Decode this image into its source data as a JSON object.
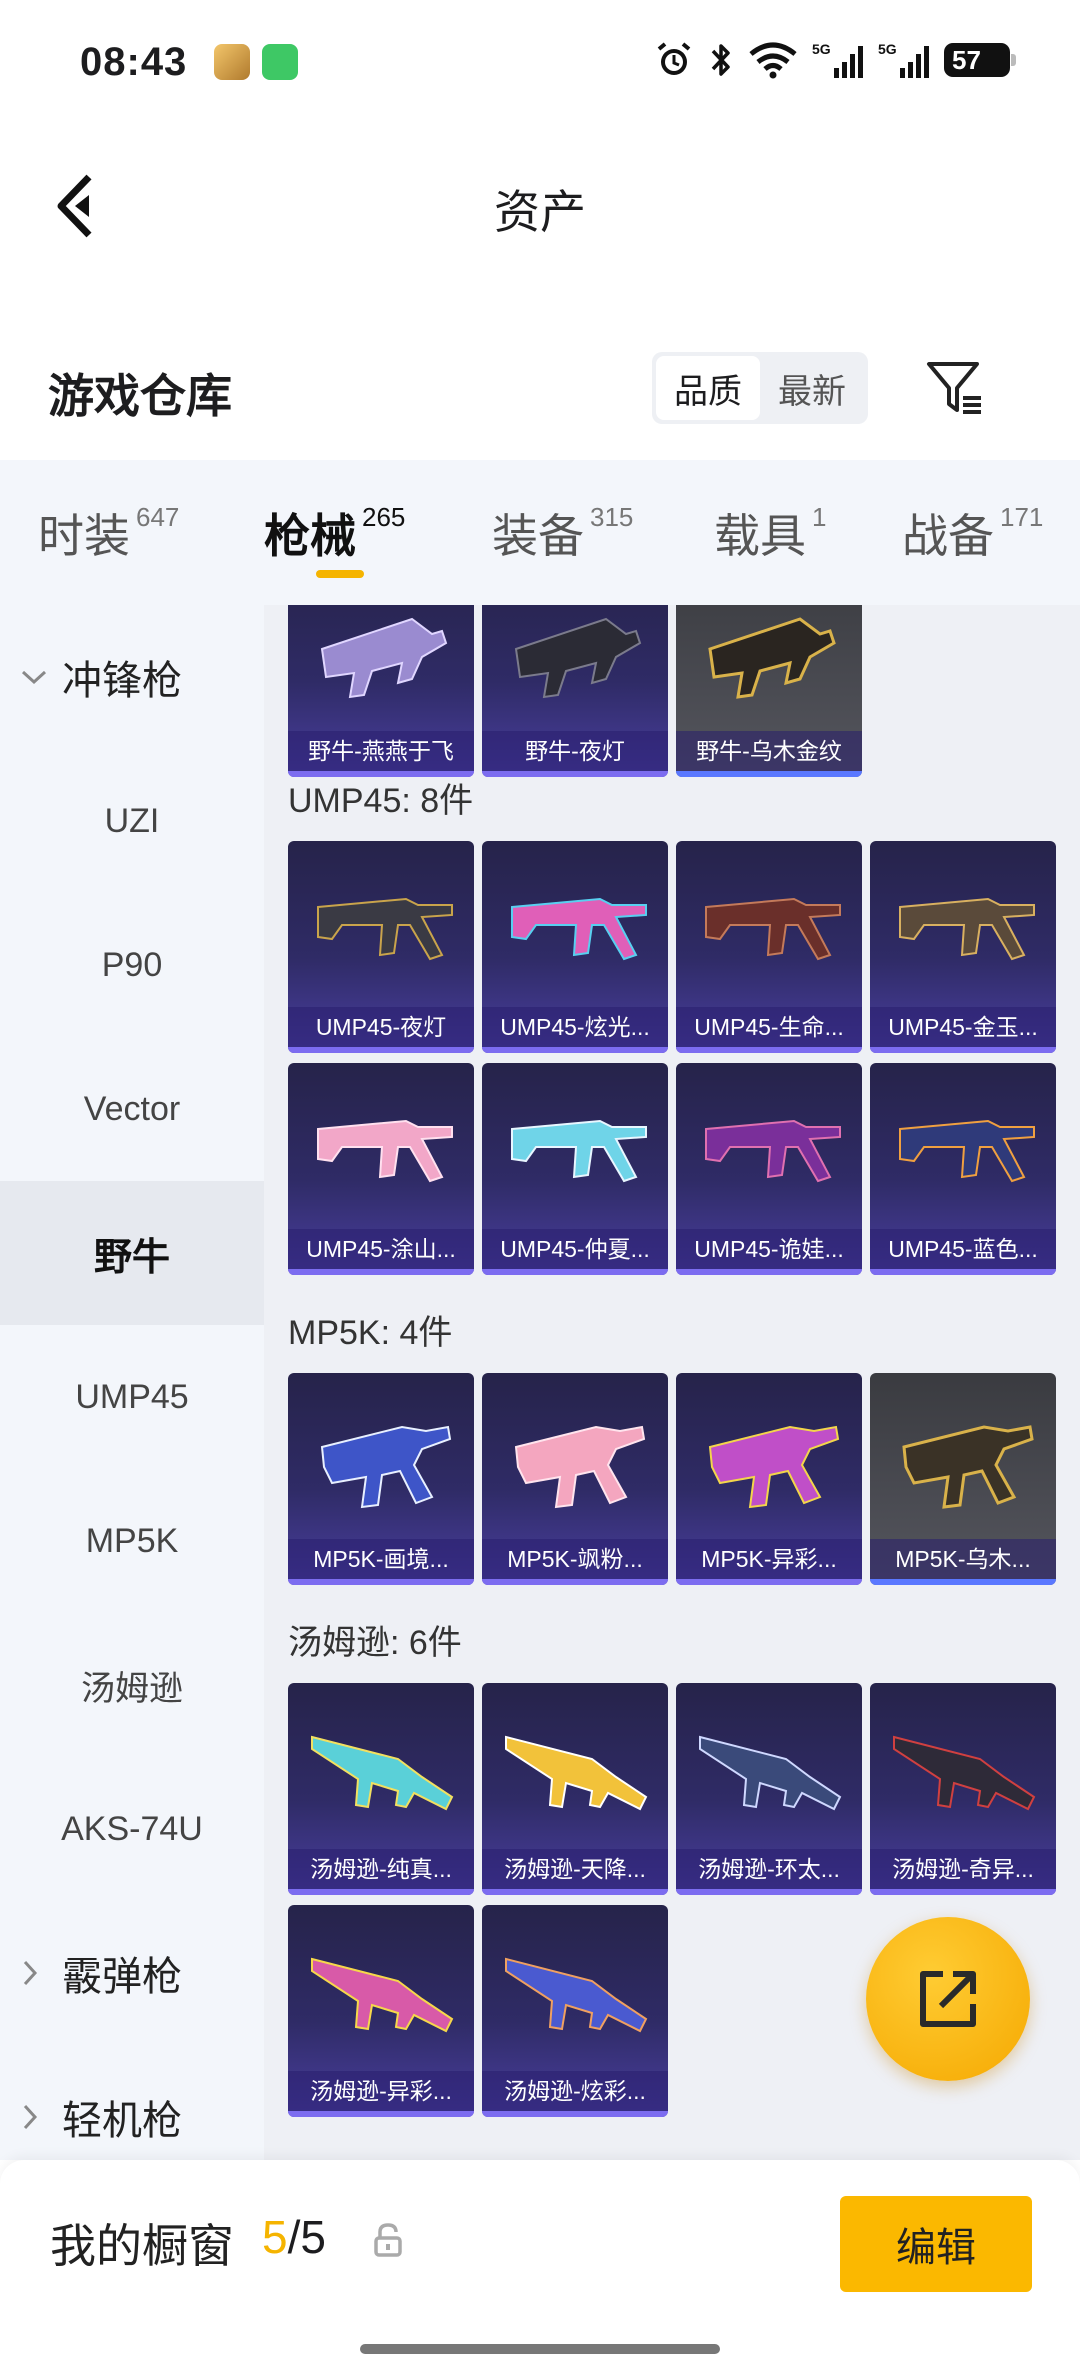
{
  "status_bar": {
    "time": "08:43",
    "battery": "57",
    "icons": [
      "alarm-icon",
      "bluetooth-icon",
      "wifi-icon",
      "signal-5g-icon",
      "signal-5g-icon",
      "battery-icon"
    ]
  },
  "header": {
    "title": "资产"
  },
  "warehouse": {
    "title": "游戏仓库",
    "sort_options": [
      "品质",
      "最新"
    ],
    "active_sort": "品质"
  },
  "category_tabs": [
    {
      "label": "时装",
      "count": "647"
    },
    {
      "label": "枪械",
      "count": "265",
      "active": true
    },
    {
      "label": "装备",
      "count": "315"
    },
    {
      "label": "载具",
      "count": "1"
    },
    {
      "label": "战备",
      "count": "171"
    }
  ],
  "sidebar": {
    "group_open": "冲锋枪",
    "items": [
      "UZI",
      "P90",
      "Vector",
      "野牛",
      "UMP45",
      "MP5K",
      "汤姆逊",
      "AKS-74U"
    ],
    "active": "野牛",
    "groups_closed": [
      "霰弹枪",
      "轻机枪"
    ]
  },
  "sections": {
    "bison_tail": {
      "cards": [
        {
          "name": "野牛-燕燕于飞",
          "rarity": "purple"
        },
        {
          "name": "野牛-夜灯",
          "rarity": "purple"
        },
        {
          "name": "野牛-乌木金纹",
          "rarity": "gray"
        }
      ]
    },
    "ump45": {
      "title": "UMP45: 8件",
      "cards": [
        {
          "name": "UMP45-夜灯"
        },
        {
          "name": "UMP45-炫光..."
        },
        {
          "name": "UMP45-生命..."
        },
        {
          "name": "UMP45-金玉..."
        },
        {
          "name": "UMP45-涂山..."
        },
        {
          "name": "UMP45-仲夏..."
        },
        {
          "name": "UMP45-诡娃..."
        },
        {
          "name": "UMP45-蓝色..."
        }
      ]
    },
    "mp5k": {
      "title": "MP5K: 4件",
      "cards": [
        {
          "name": "MP5K-画境..."
        },
        {
          "name": "MP5K-飒粉..."
        },
        {
          "name": "MP5K-异彩..."
        },
        {
          "name": "MP5K-乌木...",
          "rarity": "gray"
        }
      ]
    },
    "thompson": {
      "title": "汤姆逊: 6件",
      "cards": [
        {
          "name": "汤姆逊-纯真..."
        },
        {
          "name": "汤姆逊-天降..."
        },
        {
          "name": "汤姆逊-环太..."
        },
        {
          "name": "汤姆逊-奇异..."
        },
        {
          "name": "汤姆逊-异彩..."
        },
        {
          "name": "汤姆逊-炫彩..."
        }
      ]
    }
  },
  "bottom_bar": {
    "label": "我的橱窗",
    "current": "5",
    "separator": "/",
    "total": "5",
    "edit_label": "编辑"
  },
  "colors": {
    "accent": "#f5b400",
    "card_purple": "#2f2b66",
    "card_gray": "#4a4b52"
  }
}
